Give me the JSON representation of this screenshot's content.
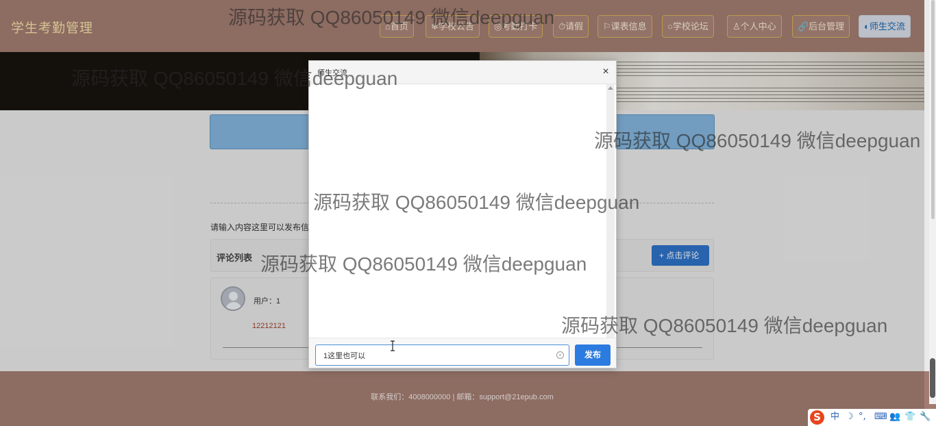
{
  "header": {
    "title": "学生考勤管理",
    "nav": [
      {
        "icon": "home-icon",
        "label": "⌂首页",
        "active": false
      },
      {
        "icon": "snowflake-icon",
        "label": "❄学校公告",
        "active": false
      },
      {
        "icon": "crosshair-icon",
        "label": "◎考勤打卡",
        "active": false
      },
      {
        "icon": "clock-icon",
        "label": "⏱请假",
        "active": false
      },
      {
        "icon": "flag-icon",
        "label": "⚐课表信息",
        "active": false
      },
      {
        "icon": "circle-icon",
        "label": "○学校论坛",
        "active": false
      },
      {
        "icon": "user-icon",
        "label": "♙个人中心",
        "active": false
      },
      {
        "icon": "link-icon",
        "label": "🔗后台管理",
        "active": false
      },
      {
        "icon": "chat-icon",
        "label": "◐师生交流",
        "active": true
      }
    ]
  },
  "page": {
    "hint": "请输入内容这里可以发布信",
    "comments": {
      "title": "评论列表",
      "add_button": "+ 点击评论",
      "items": [
        {
          "user": "用户：1",
          "text": "12212121"
        }
      ]
    }
  },
  "footer": {
    "text": "联系我们：4008000000 | 邮箱：support@21epub.com"
  },
  "dialog": {
    "title": "师生交流",
    "close": "×",
    "input_value": "1这里也可以",
    "publish_label": "发布"
  },
  "watermarks": [
    "源码获取 QQ86050149 微信deepguan",
    "源码获取 QQ86050149 微信deepguan",
    "源码获取 QQ86050149 微信deepguan",
    "源码获取 QQ86050149 微信deepguan",
    "源码获取 QQ86050149 微信deepguan",
    "源码获取 QQ86050149 微信deepguan"
  ],
  "ime": {
    "logo": "S",
    "items": [
      "中",
      "☽",
      "°,",
      "⌨",
      "👥",
      "👕",
      "🔧"
    ]
  },
  "colors": {
    "header_bg": "#a27c71",
    "accent_blue": "#2c7be0",
    "title_gold": "#f3e0a8"
  }
}
